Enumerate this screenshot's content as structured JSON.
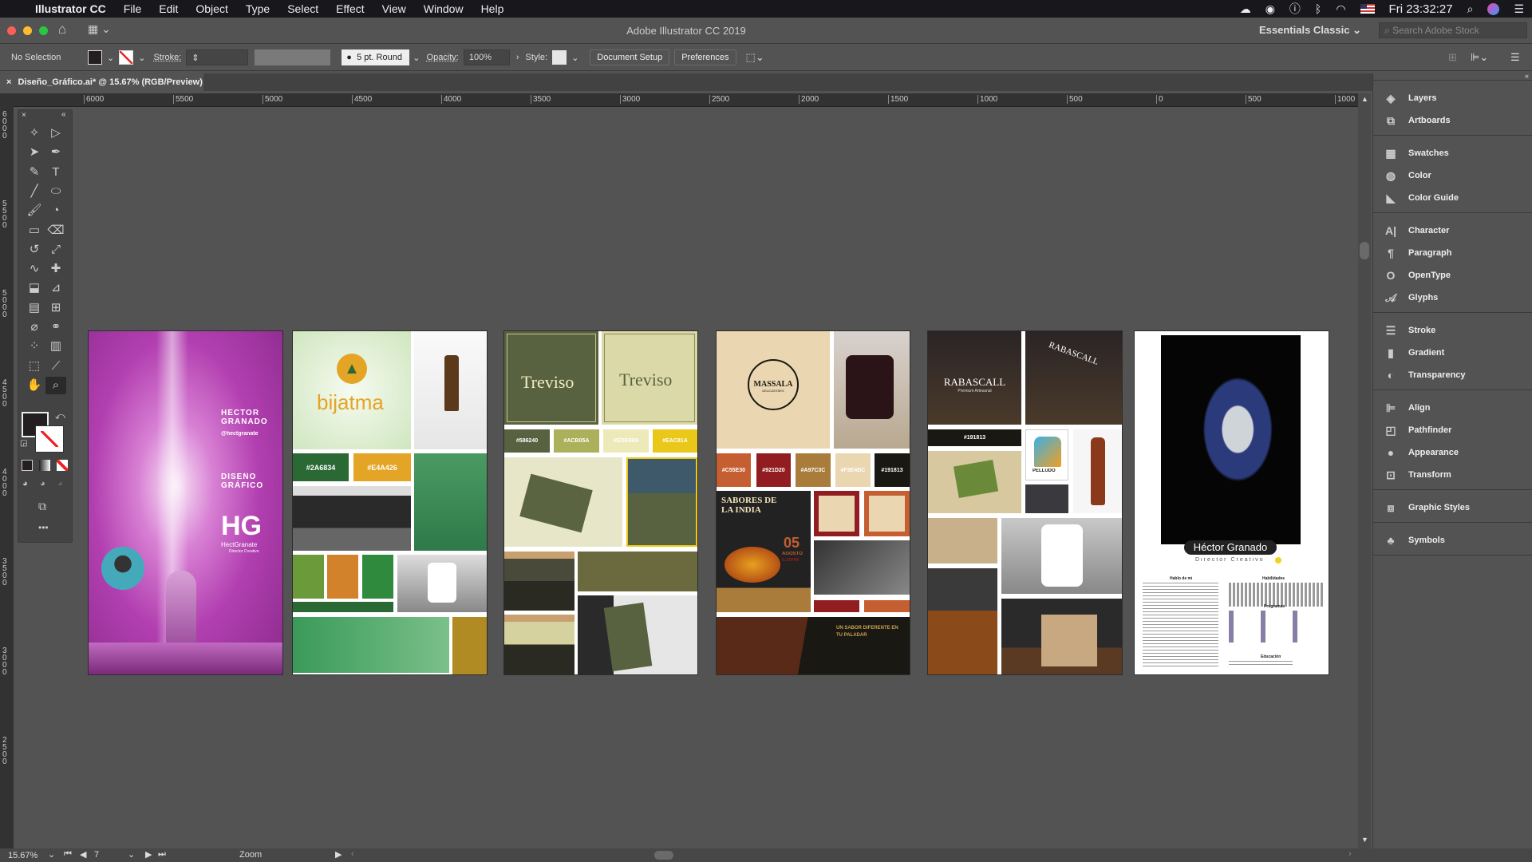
{
  "menubar": {
    "app": "Illustrator CC",
    "items": [
      "File",
      "Edit",
      "Object",
      "Type",
      "Select",
      "Effect",
      "View",
      "Window",
      "Help"
    ],
    "clock": "Fri 23:32:27"
  },
  "titlebar": {
    "title": "Adobe Illustrator CC 2019",
    "workspace": "Essentials Classic",
    "search_placeholder": "Search Adobe Stock"
  },
  "control": {
    "selection": "No Selection",
    "stroke_label": "Stroke:",
    "brush": "5 pt. Round",
    "opacity_label": "Opacity:",
    "opacity": "100%",
    "style_label": "Style:",
    "document_setup": "Document Setup",
    "preferences": "Preferences"
  },
  "document": {
    "tab": "Diseño_Gráfico.ai* @ 15.67% (RGB/Preview)"
  },
  "rulers": {
    "horizontal": [
      "6000",
      "5500",
      "5000",
      "4500",
      "4000",
      "3500",
      "3000",
      "2500",
      "2000",
      "1500",
      "1000",
      "500",
      "0",
      "500",
      "1000"
    ],
    "vertical": [
      "6000",
      "5500",
      "5000",
      "4500",
      "4000",
      "3500",
      "3000",
      "2500"
    ]
  },
  "panels": [
    {
      "items": [
        {
          "label": "Layers",
          "icon": "layers-icon",
          "g": "◈"
        },
        {
          "label": "Artboards",
          "icon": "artboards-icon",
          "g": "⧉"
        }
      ]
    },
    {
      "items": [
        {
          "label": "Swatches",
          "icon": "swatches-icon",
          "g": "▦"
        },
        {
          "label": "Color",
          "icon": "color-icon",
          "g": "◍"
        },
        {
          "label": "Color Guide",
          "icon": "color-guide-icon",
          "g": "◣"
        }
      ]
    },
    {
      "items": [
        {
          "label": "Character",
          "icon": "character-icon",
          "g": "A|"
        },
        {
          "label": "Paragraph",
          "icon": "paragraph-icon",
          "g": "¶"
        },
        {
          "label": "OpenType",
          "icon": "opentype-icon",
          "g": "O"
        },
        {
          "label": "Glyphs",
          "icon": "glyphs-icon",
          "g": "𝒜"
        }
      ]
    },
    {
      "items": [
        {
          "label": "Stroke",
          "icon": "stroke-icon",
          "g": "☰"
        },
        {
          "label": "Gradient",
          "icon": "gradient-icon",
          "g": "▮"
        },
        {
          "label": "Transparency",
          "icon": "transparency-icon",
          "g": "◐"
        }
      ]
    },
    {
      "items": [
        {
          "label": "Align",
          "icon": "align-icon",
          "g": "⊫"
        },
        {
          "label": "Pathfinder",
          "icon": "pathfinder-icon",
          "g": "◰"
        },
        {
          "label": "Appearance",
          "icon": "appearance-icon",
          "g": "●"
        },
        {
          "label": "Transform",
          "icon": "transform-icon",
          "g": "⊡"
        }
      ]
    },
    {
      "items": [
        {
          "label": "Graphic Styles",
          "icon": "graphic-styles-icon",
          "g": "⧈"
        }
      ]
    },
    {
      "items": [
        {
          "label": "Symbols",
          "icon": "symbols-icon",
          "g": "♣"
        }
      ]
    }
  ],
  "tools": [
    {
      "n": "magic-wand-tool",
      "g": "✧"
    },
    {
      "n": "direct-selection-tool",
      "g": "▷"
    },
    {
      "n": "add-anchor-tool",
      "g": "➤"
    },
    {
      "n": "pen-tool",
      "g": "✒"
    },
    {
      "n": "curvature-tool",
      "g": "✎"
    },
    {
      "n": "type-tool",
      "g": "T"
    },
    {
      "n": "line-tool",
      "g": "╱"
    },
    {
      "n": "ellipse-tool",
      "g": "⬭"
    },
    {
      "n": "paintbrush-tool",
      "g": "🖌"
    },
    {
      "n": "blob-brush-tool",
      "g": "◔"
    },
    {
      "n": "rectangle-tool",
      "g": "▭"
    },
    {
      "n": "eraser-tool",
      "g": "⌫"
    },
    {
      "n": "rotate-tool",
      "g": "↺"
    },
    {
      "n": "scale-tool",
      "g": "⤢"
    },
    {
      "n": "warp-tool",
      "g": "∿"
    },
    {
      "n": "puppet-warp-tool",
      "g": "✚"
    },
    {
      "n": "shape-builder-tool",
      "g": "⬓"
    },
    {
      "n": "perspective-grid-tool",
      "g": "⊿"
    },
    {
      "n": "gradient-tool",
      "g": "▤"
    },
    {
      "n": "mesh-tool",
      "g": "⊞"
    },
    {
      "n": "eyedropper-tool",
      "g": "⌀"
    },
    {
      "n": "blend-tool",
      "g": "⚭"
    },
    {
      "n": "symbol-sprayer-tool",
      "g": "⁘"
    },
    {
      "n": "column-graph-tool",
      "g": "▥"
    },
    {
      "n": "artboard-tool",
      "g": "⬚"
    },
    {
      "n": "slice-tool",
      "g": "⟋"
    },
    {
      "n": "hand-tool",
      "g": "✋"
    },
    {
      "n": "zoom-tool",
      "g": "⌕"
    }
  ],
  "status": {
    "zoom": "15.67%",
    "artboard": "7",
    "tool": "Zoom"
  },
  "artboards": {
    "portfolio": {
      "name": "HÉCTOR GRANADO",
      "handle": "@hectgranate",
      "title": "DISEÑO GRÁFICO",
      "brand": "HectGranate",
      "role": "Director Creativo"
    },
    "bijatma": {
      "logo": "bijatma",
      "swatches": [
        "#2A6834",
        "#E4A426"
      ]
    },
    "treviso": {
      "logo": "Treviso",
      "swatches": [
        "#586240",
        "#ACB05A",
        "#EDE9B9",
        "#EAC81A"
      ]
    },
    "massala": {
      "logo": "MASSALA",
      "sub": "DELICATESES",
      "swatches": [
        "#C55E30",
        "#921D20",
        "#A97C3C",
        "#F3E4BC",
        "#191813"
      ],
      "poster_title": "SABORES DE LA INDIA",
      "poster_day": "05",
      "poster_month": "AGOSTO",
      "poster_time": "5:30PM",
      "tagline": "UN SABOR DIFERENTE EN TU PALADAR"
    },
    "rabascall": {
      "logo": "RABASCALL",
      "sub": "Premium Artesanal",
      "swatch": "#191813",
      "label": "PELLUDO"
    },
    "cv": {
      "name": "Héctor Granado",
      "role": "Director Creativo",
      "about": "Hablo de mí",
      "skills": "Habilidades",
      "programs": "Programas",
      "education": "Educación"
    }
  },
  "colors": {
    "accent_yellow": "#f2d21b",
    "purple": "#b23fb0"
  }
}
